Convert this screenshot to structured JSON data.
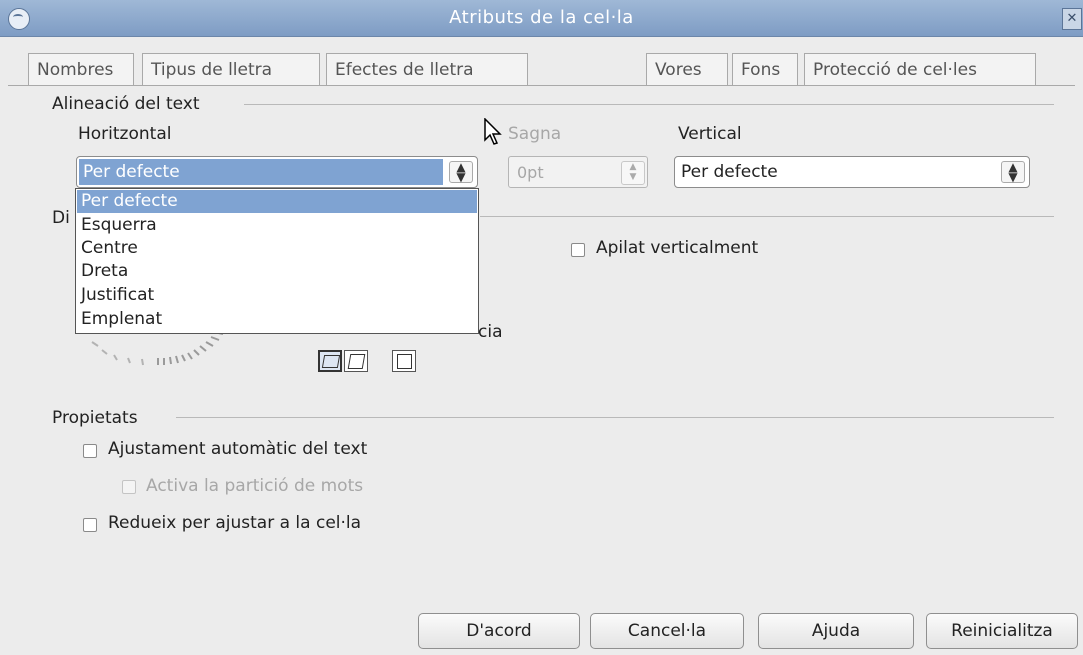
{
  "window": {
    "title": "Atributs de la cel·la"
  },
  "tabs": [
    {
      "label": "Nombres"
    },
    {
      "label": "Tipus de lletra"
    },
    {
      "label": "Efectes de lletra"
    },
    {
      "label": "Vores"
    },
    {
      "label": "Fons"
    },
    {
      "label": "Protecció de cel·les"
    }
  ],
  "alignment": {
    "group_label": "Alineació del text",
    "horizontal_label": "Horitzontal",
    "horizontal_value": "Per defecte",
    "indent_label": "Sagna",
    "indent_value": "0pt",
    "vertical_label": "Vertical",
    "vertical_value": "Per defecte"
  },
  "horizontal_options": [
    "Per defecte",
    "Esquerra",
    "Centre",
    "Dreta",
    "Justificat",
    "Emplenat"
  ],
  "orientation": {
    "group_label_fragment": "Di",
    "stacked_label": "Apilat verticalment",
    "reference_fragment": "cia"
  },
  "properties": {
    "group_label": "Propietats",
    "auto_wrap": "Ajustament automàtic del text",
    "hyphenation": "Activa la partició de mots",
    "shrink": "Redueix per ajustar a la cel·la"
  },
  "buttons": {
    "ok": "D'acord",
    "cancel": "Cancel·la",
    "help": "Ajuda",
    "reset": "Reinicialitza"
  },
  "icons": {
    "window_menu": "window-menu-icon",
    "close": "close-icon",
    "updown": "updown-arrows-icon",
    "cursor": "mouse-pointer-icon"
  }
}
